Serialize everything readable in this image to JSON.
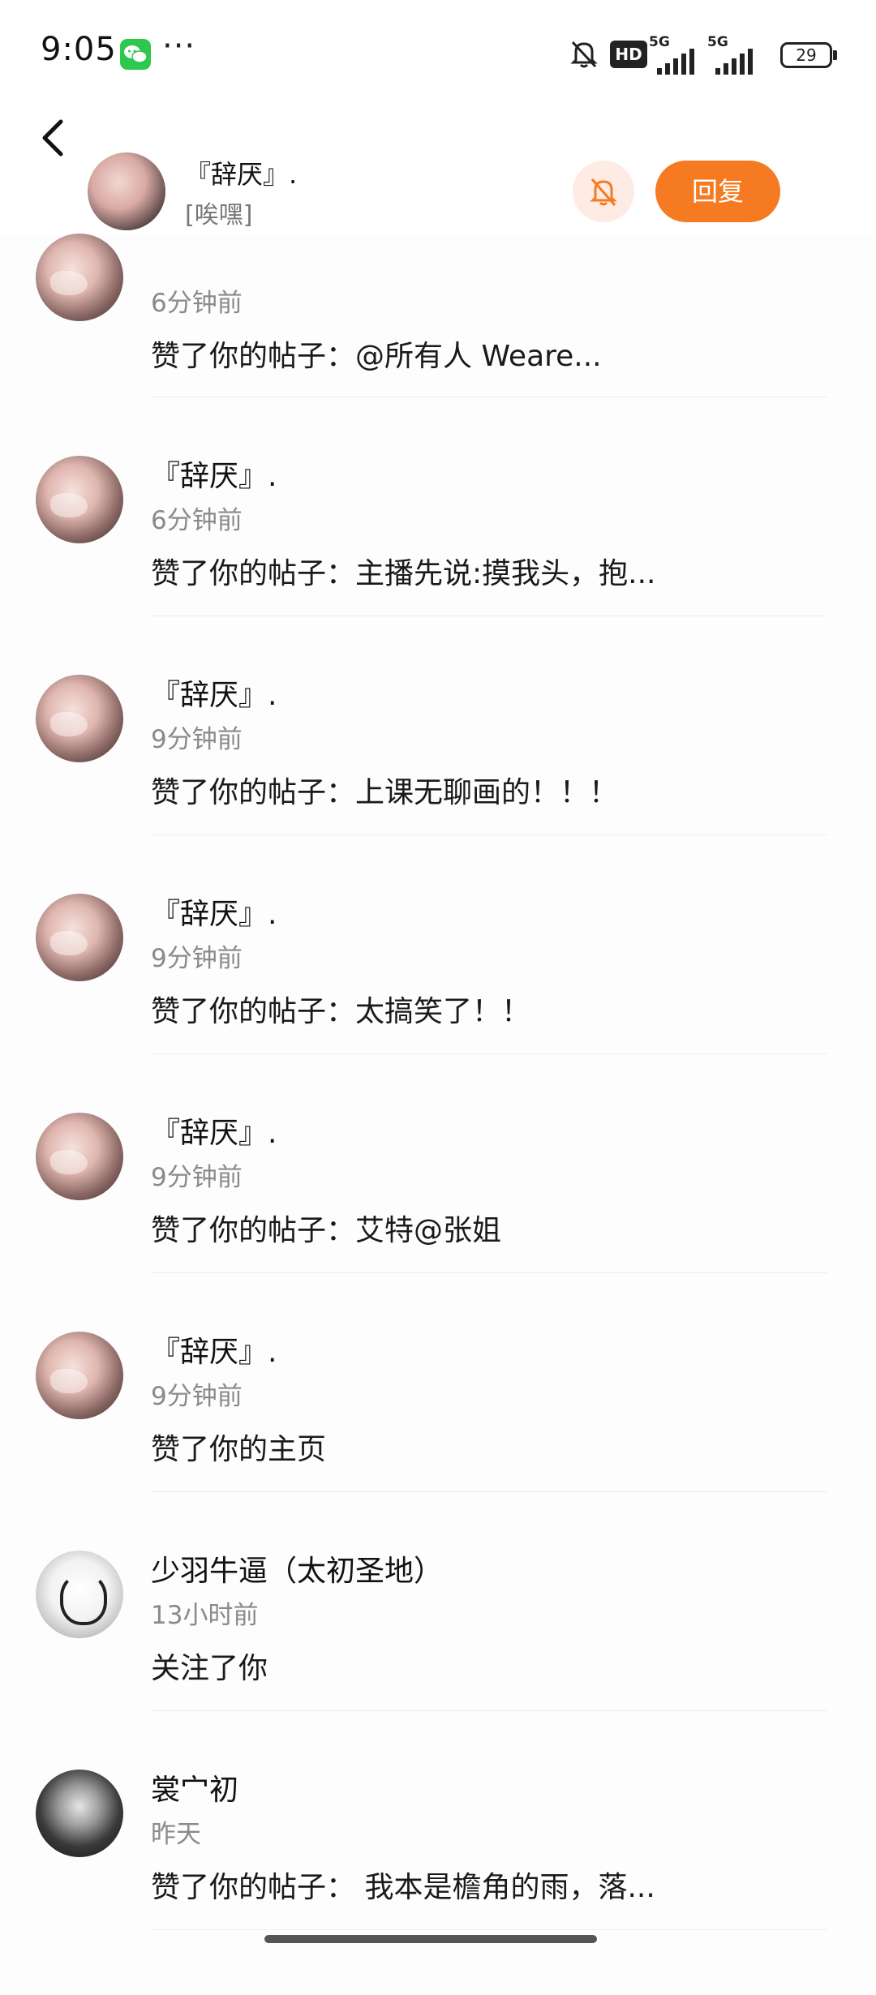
{
  "status_bar": {
    "time": "9:05",
    "more": "···",
    "hd_label": "HD",
    "sim1_label": "5G",
    "sim2_label": "5G",
    "battery": "29"
  },
  "header": {
    "name": "『辞厌』.",
    "subtitle": "[唉嘿]",
    "reply_label": "回复"
  },
  "items": [
    {
      "name": "",
      "time": "6分钟前",
      "message": "赞了你的帖子：@所有人 Weare...",
      "avatar": "avatar-girl"
    },
    {
      "name": "『辞厌』.",
      "time": "6分钟前",
      "message": "赞了你的帖子：主播先说:摸我头，抱...",
      "avatar": "avatar-girl"
    },
    {
      "name": "『辞厌』.",
      "time": "9分钟前",
      "message": "赞了你的帖子：上课无聊画的！！！",
      "avatar": "avatar-girl"
    },
    {
      "name": "『辞厌』.",
      "time": "9分钟前",
      "message": "赞了你的帖子：太搞笑了！！",
      "avatar": "avatar-girl"
    },
    {
      "name": "『辞厌』.",
      "time": "9分钟前",
      "message": "赞了你的帖子：艾特@张姐",
      "avatar": "avatar-girl"
    },
    {
      "name": "『辞厌』.",
      "time": "9分钟前",
      "message": "赞了你的主页",
      "avatar": "avatar-girl"
    },
    {
      "name": "少羽牛逼（太初圣地）",
      "time": "13小时前",
      "message": "关注了你",
      "avatar": "avatar-anime"
    },
    {
      "name": "裳宀初",
      "time": "昨天",
      "message": "赞了你的帖子： 我本是檐角的雨，落...",
      "avatar": "avatar-dark"
    }
  ],
  "colors": {
    "accent": "#f57a22",
    "bell_bg": "#fdebe4",
    "wechat_green": "#2dc84d"
  }
}
